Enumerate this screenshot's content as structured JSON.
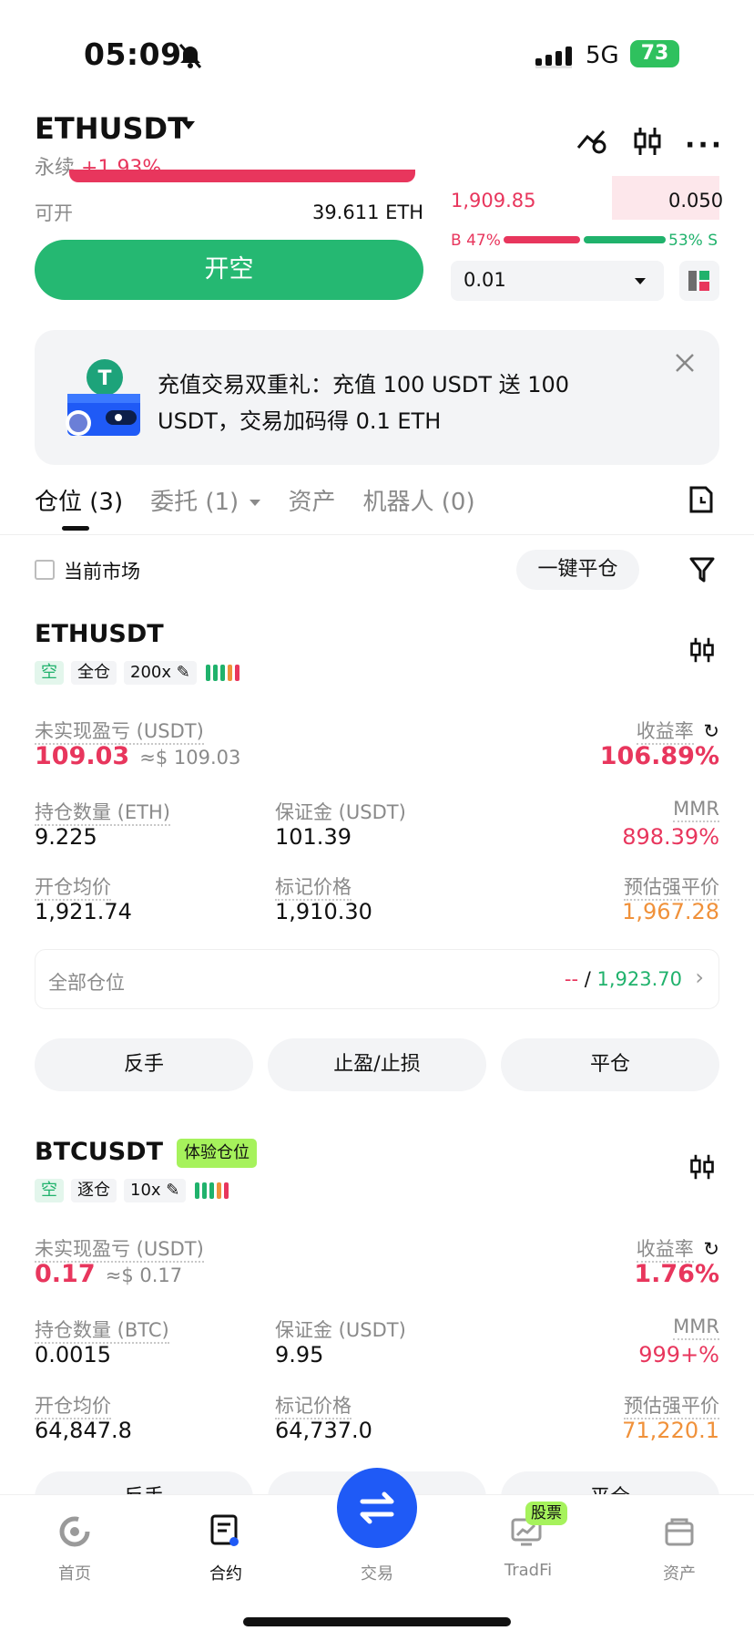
{
  "status_bar": {
    "time": "05:09",
    "network": "5G",
    "battery": "73"
  },
  "header": {
    "pair": "ETHUSDT",
    "type": "永续",
    "change": "+1.93%"
  },
  "trade": {
    "avail_label": "可开",
    "avail_value": "39.611 ETH",
    "open_button": "开空",
    "book_price": "1,909.85",
    "book_qty": "0.050",
    "buy_ratio": "B 47%",
    "sell_ratio": "53% S",
    "buy_fraction": 0.47,
    "qty_select": "0.01"
  },
  "banner": {
    "text_line1": "充值交易双重礼：充值 100 USDT 送 100",
    "text_line2": "USDT，交易加码得 0.1 ETH"
  },
  "tabs": [
    {
      "label": "仓位 (3)"
    },
    {
      "label": "委托 (1)"
    },
    {
      "label": "资产"
    },
    {
      "label": "机器人 (0)"
    }
  ],
  "filter": {
    "current_market": "当前市场",
    "close_all": "一键平仓"
  },
  "positions": [
    {
      "symbol": "ETHUSDT",
      "side": "空",
      "margin_mode": "全仓",
      "leverage": "200x",
      "pnl_label": "未实现盈亏 (USDT)",
      "pnl": "109.03",
      "pnl_usd": "≈$ 109.03",
      "roe_label": "收益率",
      "roe": "106.89%",
      "size_label": "持仓数量 (ETH)",
      "size": "9.225",
      "margin_label": "保证金 (USDT)",
      "margin": "101.39",
      "mmr_label": "MMR",
      "mmr": "898.39%",
      "entry_label": "开仓均价",
      "entry": "1,921.74",
      "mark_label": "标记价格",
      "mark": "1,910.30",
      "liq_label": "预估强平价",
      "liq": "1,967.28",
      "all_label": "全部仓位",
      "all_left": "--",
      "all_sep": "/",
      "all_right": "1,923.70",
      "btn_reverse": "反手",
      "btn_tpsl": "止盈/止损",
      "btn_close": "平仓"
    },
    {
      "symbol": "BTCUSDT",
      "badge": "体验仓位",
      "side": "空",
      "margin_mode": "逐仓",
      "leverage": "10x",
      "pnl_label": "未实现盈亏 (USDT)",
      "pnl": "0.17",
      "pnl_usd": "≈$ 0.17",
      "roe_label": "收益率",
      "roe": "1.76%",
      "size_label": "持仓数量 (BTC)",
      "size": "0.0015",
      "margin_label": "保证金 (USDT)",
      "margin": "9.95",
      "mmr_label": "MMR",
      "mmr": "999+%",
      "entry_label": "开仓均价",
      "entry": "64,847.8",
      "mark_label": "标记价格",
      "mark": "64,737.0",
      "liq_label": "预估强平价",
      "liq": "71,220.1",
      "btn_reverse": "反手",
      "btn_close": "平仓"
    }
  ],
  "bottom_nav": {
    "home": "首页",
    "contract": "合约",
    "trade": "交易",
    "tradfi": "TradFi",
    "tradfi_badge": "股票",
    "assets": "资产"
  },
  "colors": {
    "red": "#e8365d",
    "green": "#20b26c",
    "orange": "#f0913a",
    "brand_blue": "#1f5af6"
  }
}
